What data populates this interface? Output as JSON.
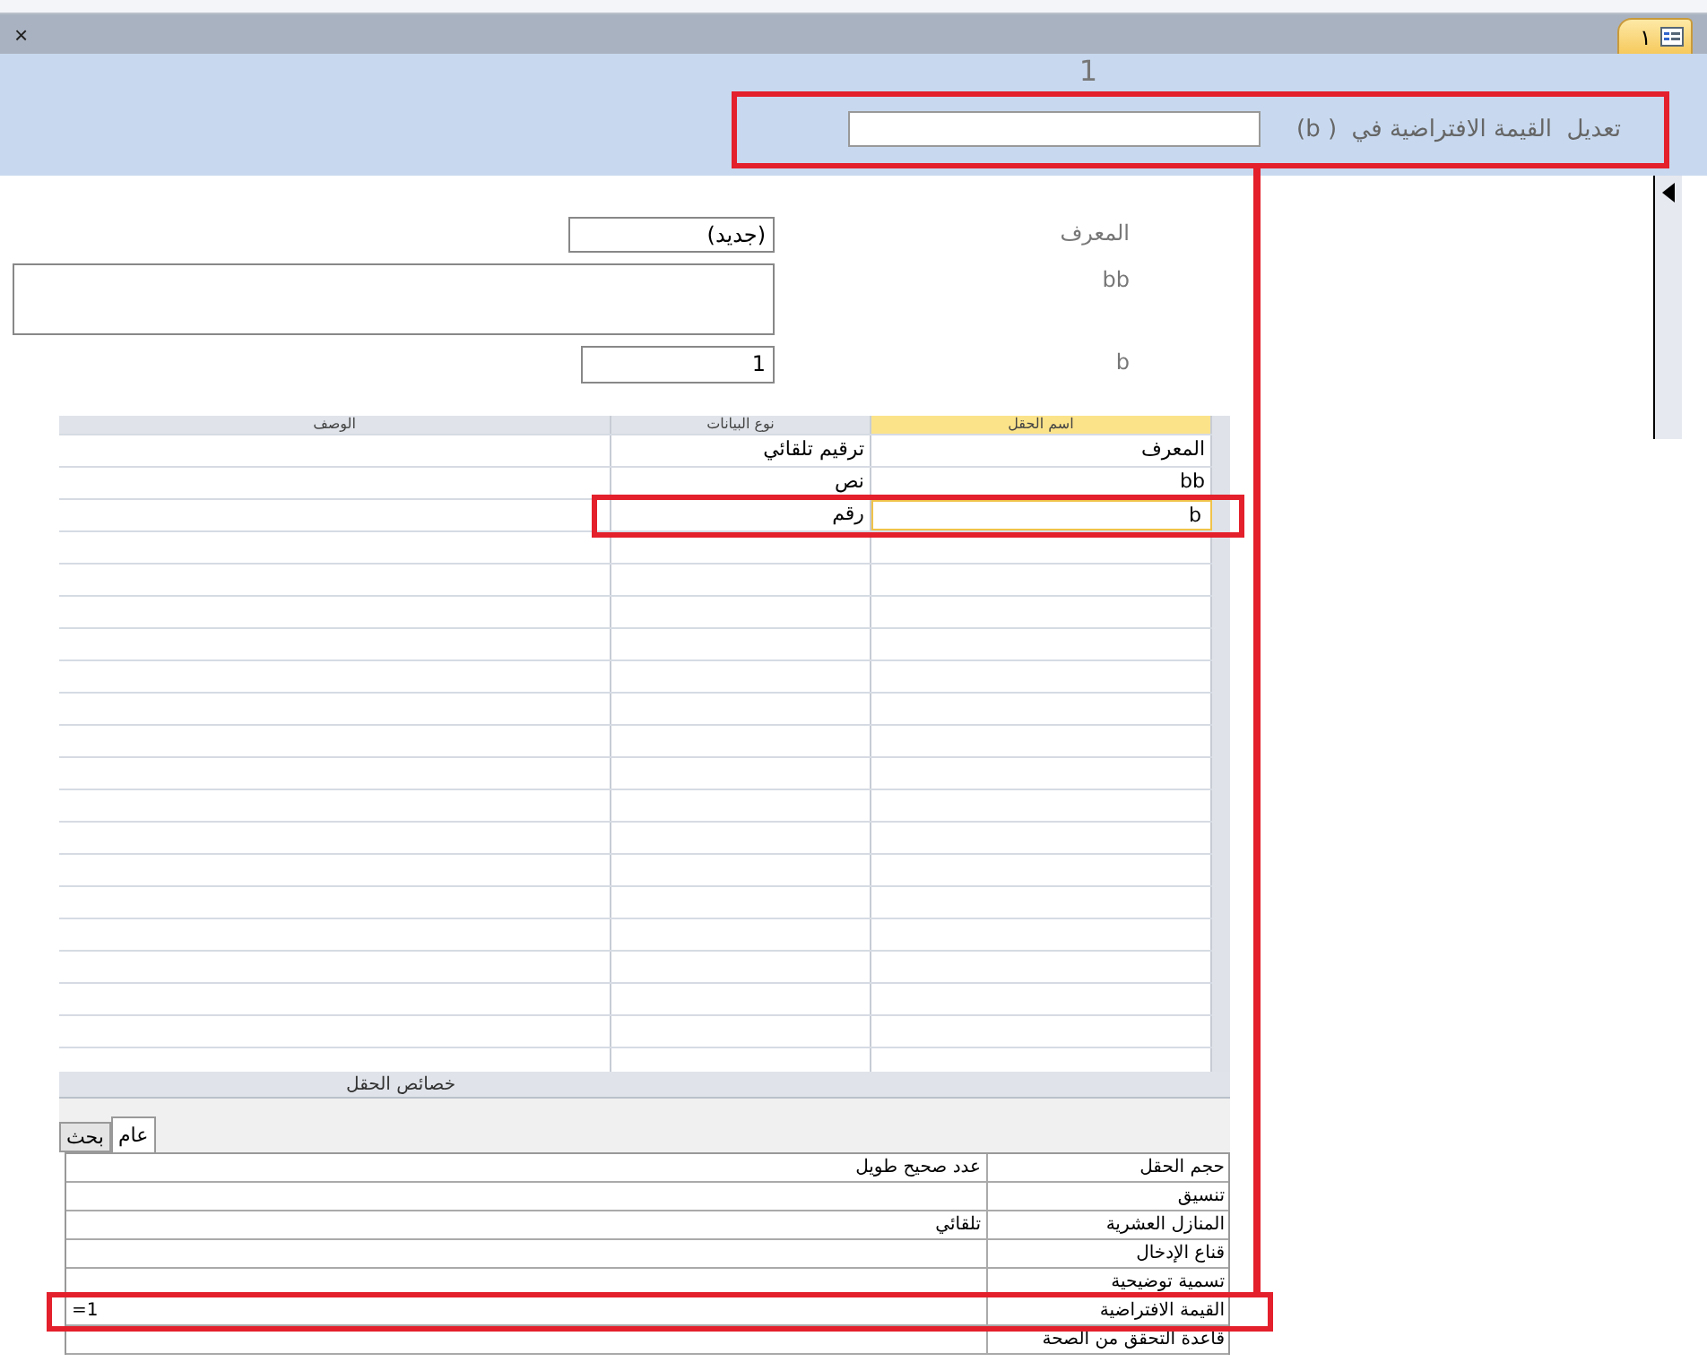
{
  "close_label": "×",
  "document_tab": {
    "label": "١",
    "selected": true
  },
  "prompt": {
    "counter": "1",
    "label": "تعديل  القيمة الافتراضية في  ( b)"
  },
  "form": {
    "fields": [
      {
        "label": "المعرف",
        "value": "(جديد)",
        "kind": "short"
      },
      {
        "label": "bb",
        "kind": "memo"
      },
      {
        "label": "b",
        "value": "1",
        "kind": "number"
      }
    ]
  },
  "design_grid": {
    "columns": [
      "اسم الحقل",
      "نوع البيانات",
      "الوصف"
    ],
    "rows": [
      {
        "field_name": "المعرف",
        "data_type": "ترقيم تلقائي",
        "selected": false
      },
      {
        "field_name": "bb",
        "data_type": "نص",
        "selected": false
      },
      {
        "field_name": "b",
        "data_type": "رقم",
        "selected": true
      }
    ]
  },
  "field_properties": {
    "title": "خصائص الحقل",
    "tabs": [
      {
        "label": "عام",
        "selected": true
      },
      {
        "label": "بحث",
        "selected": false
      }
    ],
    "rows": [
      {
        "name": "حجم الحقل",
        "value": "عدد صحيح طويل"
      },
      {
        "name": "تنسيق"
      },
      {
        "name": "المنازل العشرية",
        "value": "تلقائي"
      },
      {
        "name": "قناع الإدخال"
      },
      {
        "name": "تسمية توضيحية"
      },
      {
        "name": "القيمة الافتراضية",
        "value": "=1",
        "kind": "expression"
      },
      {
        "name": "قاعدة التحقق من الصحة"
      }
    ]
  }
}
